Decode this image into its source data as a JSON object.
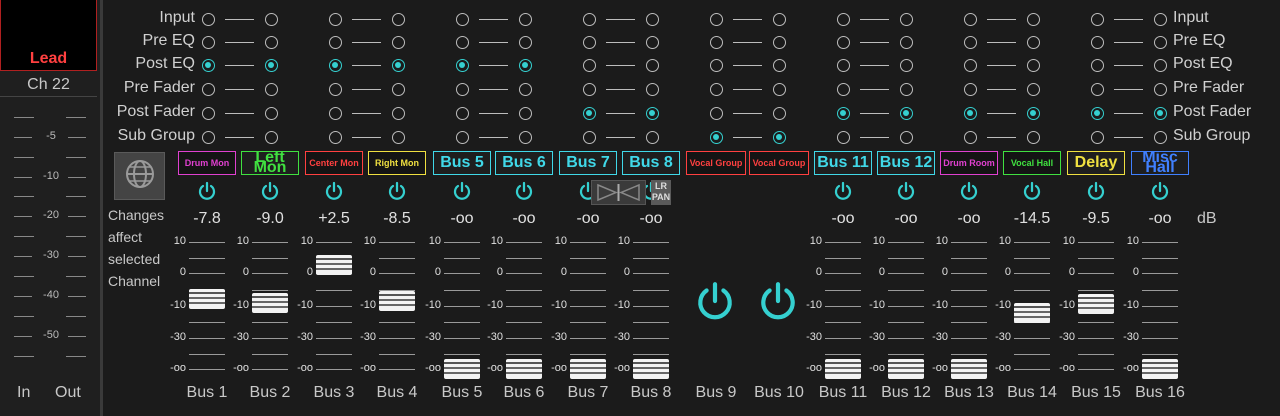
{
  "channel": {
    "name": "Lead",
    "number": "Ch 22",
    "scale": [
      "-5",
      "-10",
      "-20",
      "-30",
      "-40",
      "-50"
    ],
    "in_label": "In",
    "out_label": "Out"
  },
  "rows": [
    "Input",
    "Pre EQ",
    "Post EQ",
    "Pre Fader",
    "Post Fader",
    "Sub Group"
  ],
  "selected_row_per_pair": [
    "Post EQ",
    "Post EQ",
    "Post EQ",
    "Post Fader",
    "Sub Group",
    "Post Fader",
    "Post Fader",
    "Post Fader"
  ],
  "bus_tags": [
    {
      "label": "Drum Mon",
      "color": "#e040d0",
      "small": true
    },
    {
      "label": "Left Mon",
      "color": "#40e040",
      "small": false
    },
    {
      "label": "Center Mon",
      "color": "#ff4040",
      "small": true
    },
    {
      "label": "Right Mon",
      "color": "#f0e040",
      "small": true
    },
    {
      "label": "Bus 5",
      "color": "#40d8e8",
      "small": false
    },
    {
      "label": "Bus 6",
      "color": "#40d8e8",
      "small": false
    },
    {
      "label": "Bus 7",
      "color": "#40d8e8",
      "small": false
    },
    {
      "label": "Bus 8",
      "color": "#40d8e8",
      "small": false
    },
    {
      "label": "Vocal Group",
      "color": "#ff4040",
      "small": true
    },
    {
      "label": "Vocal Group",
      "color": "#ff4040",
      "small": true
    },
    {
      "label": "Bus 11",
      "color": "#40d8e8",
      "small": false
    },
    {
      "label": "Bus 12",
      "color": "#40d8e8",
      "small": false
    },
    {
      "label": "Drum Room",
      "color": "#e040d0",
      "small": true
    },
    {
      "label": "Vocal Hall",
      "color": "#40e040",
      "small": true
    },
    {
      "label": "Delay",
      "color": "#f0e040",
      "small": false
    },
    {
      "label": "Misc Hall",
      "color": "#4080ff",
      "small": false
    }
  ],
  "db_values": [
    "-7.8",
    "-9.0",
    "+2.5",
    "-8.5",
    "-oo",
    "-oo",
    "-oo",
    "-oo",
    "",
    "",
    "-oo",
    "-oo",
    "-oo",
    "-14.5",
    "-9.5",
    "-oo"
  ],
  "db_unit": "dB",
  "fader_levels_db": [
    -7.8,
    -9.0,
    2.5,
    -8.5,
    null,
    null,
    null,
    null,
    null,
    null,
    null,
    null,
    null,
    -14.5,
    -9.5,
    null
  ],
  "scale_ticks": [
    "10",
    "0",
    "-10",
    "-30",
    "-oo"
  ],
  "bus_labels": [
    "Bus 1",
    "Bus 2",
    "Bus 3",
    "Bus 4",
    "Bus 5",
    "Bus 6",
    "Bus 7",
    "Bus 8",
    "Bus 9",
    "Bus 10",
    "Bus 11",
    "Bus 12",
    "Bus 13",
    "Bus 14",
    "Bus 15",
    "Bus 16"
  ],
  "changes_note": [
    "Changes",
    "affect",
    "selected",
    "Channel"
  ],
  "lr_pan_label": "LR PAN",
  "accent": "#35d0d0"
}
